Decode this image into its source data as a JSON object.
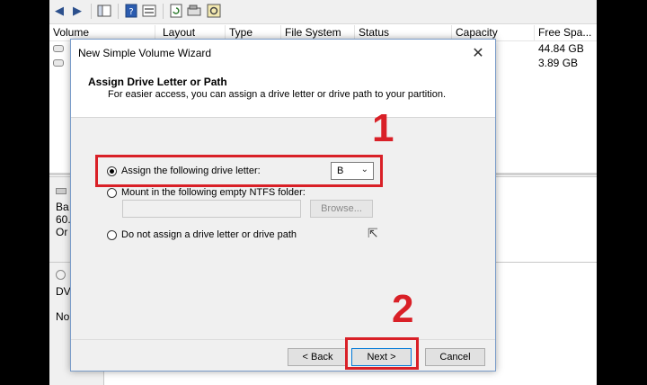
{
  "toolbar": {
    "icons": [
      "back-arrow-icon",
      "forward-arrow-icon",
      "console-tree-icon",
      "help-icon",
      "properties-icon",
      "refresh-icon",
      "disk-icon",
      "settings-icon"
    ]
  },
  "columns": {
    "volume": "Volume",
    "layout": "Layout",
    "type": "Type",
    "filesystem": "File System",
    "status": "Status",
    "capacity": "Capacity",
    "free_space": "Free Spa..."
  },
  "volume_rows": [
    {
      "free_space": "44.84 GB"
    },
    {
      "free_space": "3.89 GB"
    }
  ],
  "disk_labels": {
    "disk1_line1": "Ba",
    "disk1_line2": "60.",
    "disk1_line3": "Or",
    "disk2_line1": "DV",
    "disk2_line2": "No"
  },
  "dialog": {
    "title": "New Simple Volume Wizard",
    "close": "✕",
    "header_title": "Assign Drive Letter or Path",
    "header_subtitle": "For easier access, you can assign a drive letter or drive path to your partition.",
    "options": {
      "assign_letter": "Assign the following drive letter:",
      "mount_folder": "Mount in the following empty NTFS folder:",
      "no_assign": "Do not assign a drive letter or drive path"
    },
    "drive_letter": "B",
    "browse_label": "Browse...",
    "folder_path": "",
    "back_label": "< Back",
    "next_label": "Next >",
    "cancel_label": "Cancel"
  },
  "annotations": {
    "step1": "1",
    "step2": "2"
  },
  "colors": {
    "annotation_red": "#d92027",
    "disk_bar_blue": "#00008b"
  }
}
